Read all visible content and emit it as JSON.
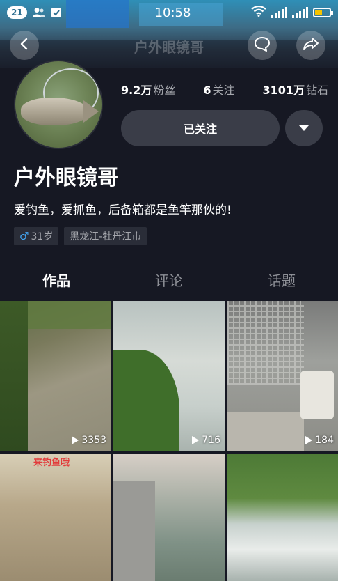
{
  "status_bar": {
    "notification_count": "21",
    "time": "10:58",
    "icons": [
      "person-icon",
      "shield-check-icon",
      "wifi-icon",
      "signal-icon",
      "signal-icon",
      "battery-icon"
    ],
    "battery_color": "#f5c400"
  },
  "nav": {
    "title": "户外眼镜哥",
    "back_icon": "back-arrow-icon",
    "chat_icon": "chat-bubble-icon",
    "share_icon": "share-arrow-icon"
  },
  "profile": {
    "stats": [
      {
        "value": "9.2万",
        "label": "粉丝"
      },
      {
        "value": "6",
        "label": "关注"
      },
      {
        "value": "3101万",
        "label": "钻石"
      }
    ],
    "follow_button": "已关注",
    "name": "户外眼镜哥",
    "bio": "爱钓鱼，爱抓鱼，后备箱都是鱼竿那伙的!",
    "gender_symbol": "♂",
    "age": "31岁",
    "location": "黑龙江-牡丹江市"
  },
  "tabs": [
    {
      "label": "作品",
      "active": true
    },
    {
      "label": "评论",
      "active": false
    },
    {
      "label": "话题",
      "active": false
    }
  ],
  "videos": [
    {
      "plays": "3353"
    },
    {
      "plays": "716"
    },
    {
      "plays": "184"
    },
    {
      "overlay_text": "来钓鱼哦"
    },
    {},
    {}
  ],
  "colors": {
    "background": "#161823",
    "button_bg": "#3a3d48",
    "muted_text": "#a5a7ad",
    "gender_blue": "#43a7f5"
  }
}
